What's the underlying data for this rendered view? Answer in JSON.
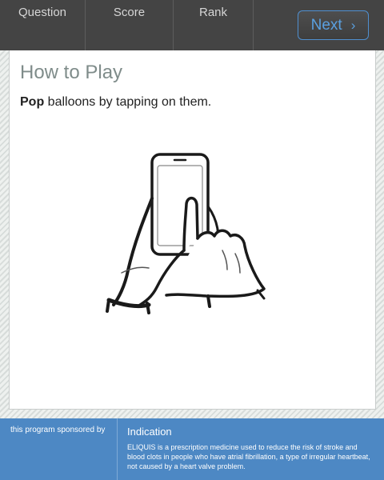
{
  "topbar": {
    "question_label": "Question",
    "score_label": "Score",
    "rank_label": "Rank",
    "next_label": "Next",
    "next_icon": "chevron-right-icon"
  },
  "card": {
    "title": "How to Play",
    "instruction_bold": "Pop",
    "instruction_rest": " balloons by tapping on them."
  },
  "footer": {
    "sponsor_label": "this program sponsored by",
    "indication_title": "Indication",
    "indication_text": "ELIQUIS is a prescription medicine used to reduce the risk of stroke and blood clots in people who have atrial fibrillation, a type of irregular heartbeat, not caused by a heart valve problem."
  },
  "colors": {
    "topbar": "#444444",
    "accent": "#4f8fcf",
    "footer": "#4d88c4"
  }
}
